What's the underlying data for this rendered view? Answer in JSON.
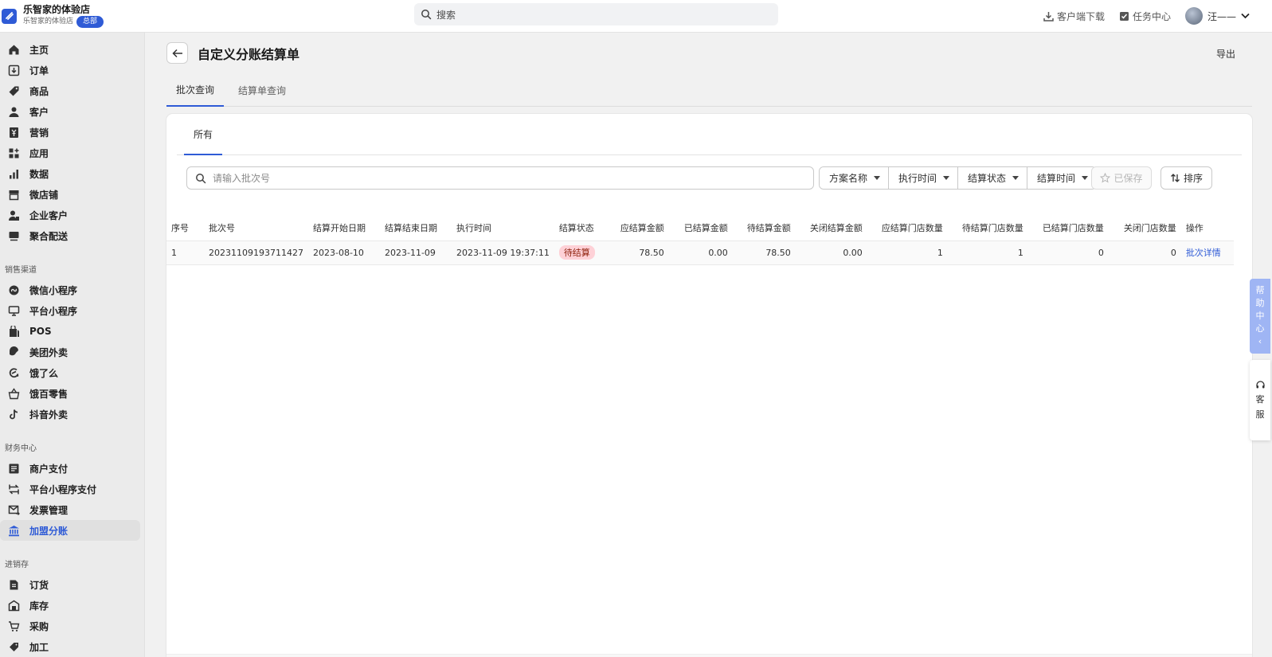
{
  "brand": {
    "name": "乐智家的体验店",
    "subname": "乐智家的体验店",
    "badge": "总部"
  },
  "search": {
    "placeholder": "搜索"
  },
  "topbar": {
    "download": "客户端下载",
    "tasks": "任务中心",
    "user": "汪——"
  },
  "sidebar": {
    "main": [
      {
        "label": "主页",
        "icon": "home-icon"
      },
      {
        "label": "订单",
        "icon": "order-icon"
      },
      {
        "label": "商品",
        "icon": "tag-icon"
      },
      {
        "label": "客户",
        "icon": "person-icon"
      },
      {
        "label": "营销",
        "icon": "yen-icon"
      },
      {
        "label": "应用",
        "icon": "apps-icon"
      },
      {
        "label": "数据",
        "icon": "bar-chart-icon"
      },
      {
        "label": "微店铺",
        "icon": "store-icon"
      },
      {
        "label": "企业客户",
        "icon": "enterprise-icon"
      },
      {
        "label": "聚合配送",
        "icon": "delivery-icon"
      }
    ],
    "sales_title": "销售渠道",
    "sales": [
      {
        "label": "微信小程序",
        "icon": "wechat-mini-icon"
      },
      {
        "label": "平台小程序",
        "icon": "platform-mini-icon"
      },
      {
        "label": "POS",
        "icon": "pos-icon"
      },
      {
        "label": "美团外卖",
        "icon": "meituan-icon"
      },
      {
        "label": "饿了么",
        "icon": "eleme-icon"
      },
      {
        "label": "饿百零售",
        "icon": "basket-icon"
      },
      {
        "label": "抖音外卖",
        "icon": "tiktok-icon"
      }
    ],
    "finance_title": "财务中心",
    "finance": [
      {
        "label": "商户支付",
        "icon": "merchant-pay-icon"
      },
      {
        "label": "平台小程序支付",
        "icon": "transfer-icon"
      },
      {
        "label": "发票管理",
        "icon": "invoice-icon"
      },
      {
        "label": "加盟分账",
        "icon": "bank-icon",
        "active": true
      }
    ],
    "inventory_title": "进销存",
    "inventory": [
      {
        "label": "订货",
        "icon": "document-icon"
      },
      {
        "label": "库存",
        "icon": "warehouse-icon"
      },
      {
        "label": "采购",
        "icon": "cart-icon"
      },
      {
        "label": "加工",
        "icon": "process-icon"
      }
    ]
  },
  "page": {
    "title": "自定义分账结算单",
    "export": "导出",
    "tabs": [
      "批次查询",
      "结算单查询"
    ],
    "subtab": "所有",
    "filter": {
      "search_placeholder": "请输入批次号",
      "dropdowns": [
        "方案名称",
        "执行时间",
        "结算状态",
        "结算时间"
      ],
      "save": "已保存",
      "sort": "排序"
    }
  },
  "table": {
    "columns": [
      "序号",
      "批次号",
      "结算开始日期",
      "结算结束日期",
      "执行时间",
      "结算状态",
      "应结算金额",
      "已结算金额",
      "待结算金额",
      "关闭结算金额",
      "应结算门店数量",
      "待结算门店数量",
      "已结算门店数量",
      "关闭门店数量",
      "操作"
    ],
    "rows": [
      {
        "index": "1",
        "batch": "20231109193711427",
        "start": "2023-08-10",
        "end": "2023-11-09",
        "exec": "2023-11-09 19:37:11",
        "status": "待结算",
        "due": "78.50",
        "settled": "0.00",
        "pending": "78.50",
        "closed": "0.00",
        "due_stores": "1",
        "pending_stores": "1",
        "settled_stores": "0",
        "closed_stores": "0",
        "action": "批次详情"
      }
    ]
  },
  "float": {
    "help": [
      "帮",
      "助",
      "中",
      "心",
      "‹"
    ],
    "service": [
      "客",
      "服"
    ]
  },
  "colors": {
    "accent": "#2f5bd6",
    "status_bg": "#fed1d7",
    "help_tab": "#9fb5f4"
  }
}
